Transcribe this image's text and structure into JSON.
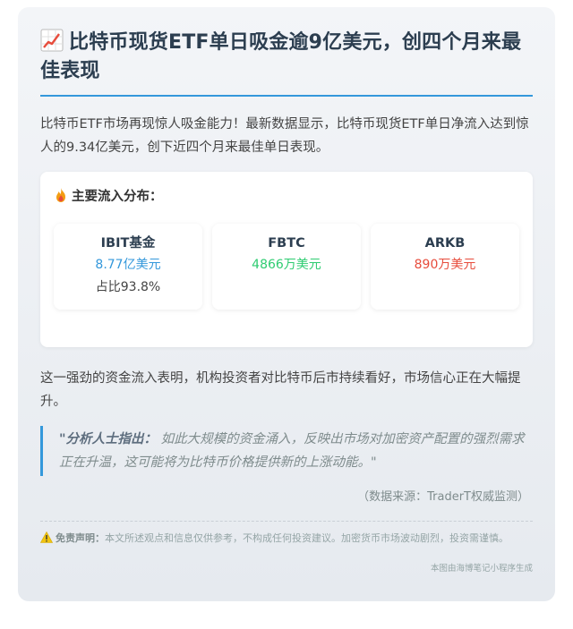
{
  "article": {
    "title": "比特币现货ETF单日吸金逾9亿美元，创四个月来最佳表现",
    "title_icon": "chart-up-icon",
    "intro": "比特币ETF市场再现惊人吸金能力！最新数据显示，比特币现货ETF单日净流入达到惊人的9.34亿美元，创下近四个月来最佳单日表现。",
    "distribution": {
      "heading": "主要流入分布：",
      "icon": "fire-icon",
      "funds": [
        {
          "name": "IBIT基金",
          "amount": "8.77亿美元",
          "share": "占比93.8%",
          "color": "#3498db"
        },
        {
          "name": "FBTC",
          "amount": "4866万美元",
          "share": "",
          "color": "#2ecc71"
        },
        {
          "name": "ARKB",
          "amount": "890万美元",
          "share": "",
          "color": "#e74c3c"
        }
      ]
    },
    "paragraph": "这一强劲的资金流入表明，机构投资者对比特币后市持续看好，市场信心正在大幅提升。",
    "quote": {
      "lead": "\"分析人士指出：",
      "text": "如此大规模的资金涌入，反映出市场对加密资产配置的强烈需求正在升温，这可能将为比特币价格提供新的上涨动能。\""
    },
    "source": "（数据来源：TraderT权威监测）",
    "disclaimer": {
      "icon": "warning-icon",
      "label": "免责声明：",
      "text": "本文所述观点和信息仅供参考，不构成任何投资建议。加密货币市场波动剧烈，投资需谨慎。"
    },
    "footer": "本图由海博笔记小程序生成"
  }
}
